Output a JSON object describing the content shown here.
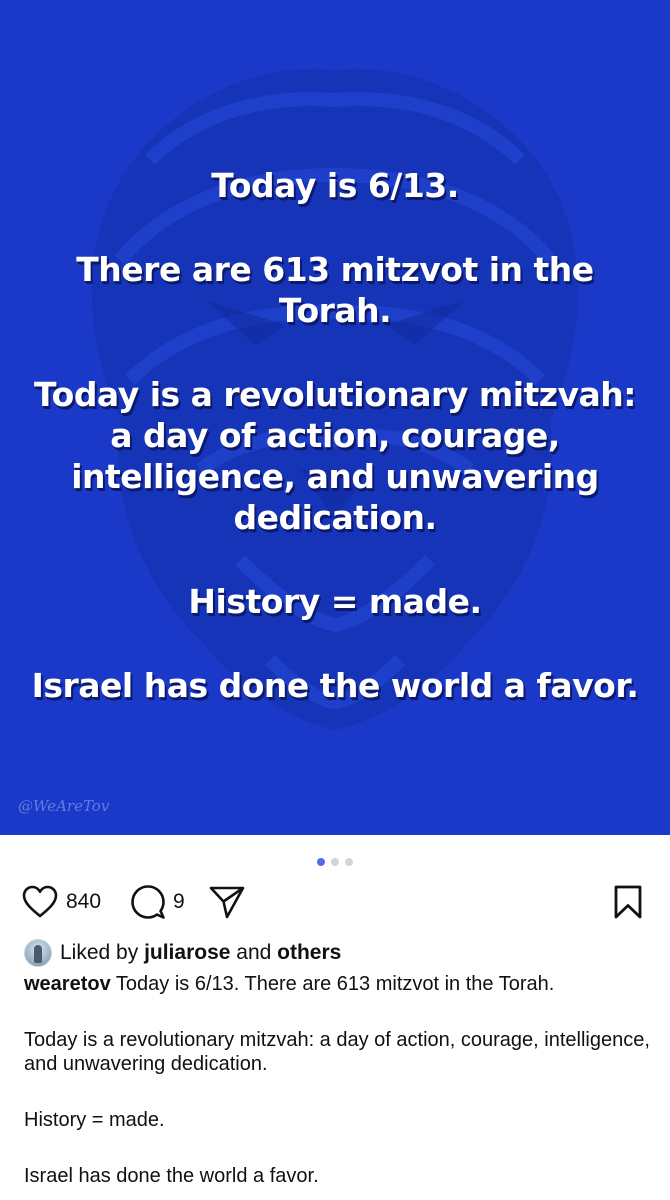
{
  "post": {
    "image_lines": [
      "Today is 6/13.",
      "There are 613 mitzvot in the Torah.",
      "Today is a revolutionary mitzvah:\na day of action, courage,\nintelligence, and unwavering\ndedication.",
      "History = made.",
      "Israel has done the world a favor."
    ],
    "image_credit": "@WeAreTov",
    "carousel": {
      "total": 3,
      "active": 1
    }
  },
  "actions": {
    "like_count": "840",
    "comment_count": "9",
    "icons": [
      "heart-icon",
      "comment-icon",
      "share-icon",
      "bookmark-icon"
    ]
  },
  "likes": {
    "prefix": "Liked by ",
    "user": "juliarose",
    "middle": " and ",
    "others": "others"
  },
  "caption": {
    "username": "wearetov",
    "line1": " Today is 6/13. There are 613 mitzvot in the Torah.",
    "paragraph2": "Today is a revolutionary mitzvah: a day of action, courage, intelligence, and unwavering dedication.",
    "paragraph3": "History = made.",
    "paragraph4": "Israel has done the world a favor."
  },
  "colors": {
    "image_background": "#1a39c9",
    "carousel_active": "#4f6be8",
    "carousel_inactive": "#d4d4d8"
  }
}
